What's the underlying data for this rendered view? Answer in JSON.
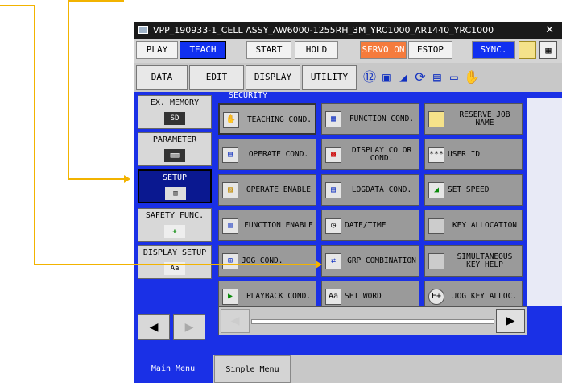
{
  "window": {
    "title": "VPP_190933-1_CELL ASSY_AW6000-1255RH_3M_YRC1000_AR1440_YRC1000",
    "close": "✕"
  },
  "toolbar": {
    "play": "PLAY",
    "teach": "TEACH",
    "start": "START",
    "hold": "HOLD",
    "servo_on": "SERVO ON",
    "estop": "ESTOP",
    "sync": "SYNC."
  },
  "menu": {
    "data": "DATA",
    "edit": "EDIT",
    "display": "DISPLAY",
    "utility": "UTILITY"
  },
  "status_icons": [
    "tool-number-icon",
    "coordinate-icon",
    "speed-icon",
    "cycle-icon",
    "job-icon",
    "page-icon",
    "hand-icon"
  ],
  "left_menu": [
    {
      "label": "EX. MEMORY",
      "icon": "sd-card-icon",
      "icon_text": "SD"
    },
    {
      "label": "PARAMETER",
      "icon": "parameter-icon",
      "icon_text": ""
    },
    {
      "label": "SETUP",
      "icon": "setup-icon",
      "icon_text": ""
    },
    {
      "label": "SAFETY FUNC.",
      "icon": "safety-icon",
      "icon_text": ""
    },
    {
      "label": "DISPLAY SETUP",
      "icon": "display-setup-icon",
      "icon_text": "Aa"
    }
  ],
  "section_title": "SECURITY",
  "grid": [
    [
      {
        "label": "TEACHING COND.",
        "icon": "teaching-icon"
      },
      {
        "label": "FUNCTION COND.",
        "icon": "function-cond-icon"
      },
      {
        "label": "RESERVE JOB\nNAME",
        "icon": "reserve-job-icon"
      }
    ],
    [
      {
        "label": "OPERATE COND.",
        "icon": "operate-icon"
      },
      {
        "label": "DISPLAY COLOR\nCOND.",
        "icon": "display-color-icon"
      },
      {
        "label": "USER ID",
        "icon": "user-id-icon",
        "icon_text": "***"
      }
    ],
    [
      {
        "label": "OPERATE ENABLE",
        "icon": "operate-enable-icon"
      },
      {
        "label": "LOGDATA COND.",
        "icon": "logdata-icon"
      },
      {
        "label": "SET SPEED",
        "icon": "set-speed-icon"
      }
    ],
    [
      {
        "label": "FUNCTION ENABLE",
        "icon": "function-enable-icon"
      },
      {
        "label": "DATE/TIME",
        "icon": "clock-icon"
      },
      {
        "label": "KEY ALLOCATION",
        "icon": "key-icon"
      }
    ],
    [
      {
        "label": "JOG COND.",
        "icon": "jog-icon"
      },
      {
        "label": "GRP COMBINATION",
        "icon": "grp-icon"
      },
      {
        "label": "SIMULTANEOUS\nKEY HELP",
        "icon": "key-help-icon"
      }
    ],
    [
      {
        "label": "PLAYBACK COND.",
        "icon": "playback-icon"
      },
      {
        "label": "SET WORD",
        "icon": "set-word-icon",
        "icon_text": "Aa"
      },
      {
        "label": "JOG KEY ALLOC.",
        "icon": "jog-key-icon",
        "icon_text": "E+"
      }
    ]
  ],
  "bottom_tabs": {
    "main": "Main Menu",
    "simple": "Simple Menu"
  },
  "colors": {
    "panel_blue": "#1a30e6",
    "accent_orange": "#f57b3c",
    "callout": "#f2b300"
  }
}
